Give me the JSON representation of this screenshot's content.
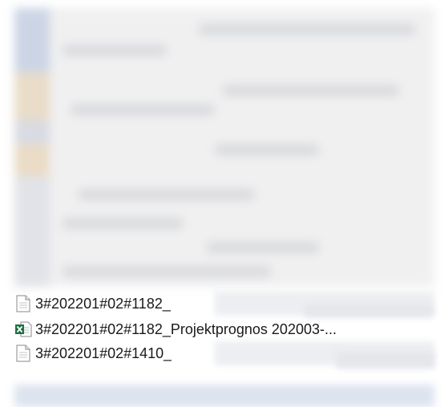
{
  "files": [
    {
      "name": "3#202201#02#1182_",
      "icon": "text-document-icon"
    },
    {
      "name": "3#202201#02#1182_Projektprognos 202003-...",
      "icon": "excel-file-icon"
    },
    {
      "name": "3#202201#02#1410_",
      "icon": "text-document-icon"
    }
  ],
  "colors": {
    "excel_green": "#1e7145",
    "text": "#1a1a1a",
    "blur_strip": "#c7d2e3"
  }
}
